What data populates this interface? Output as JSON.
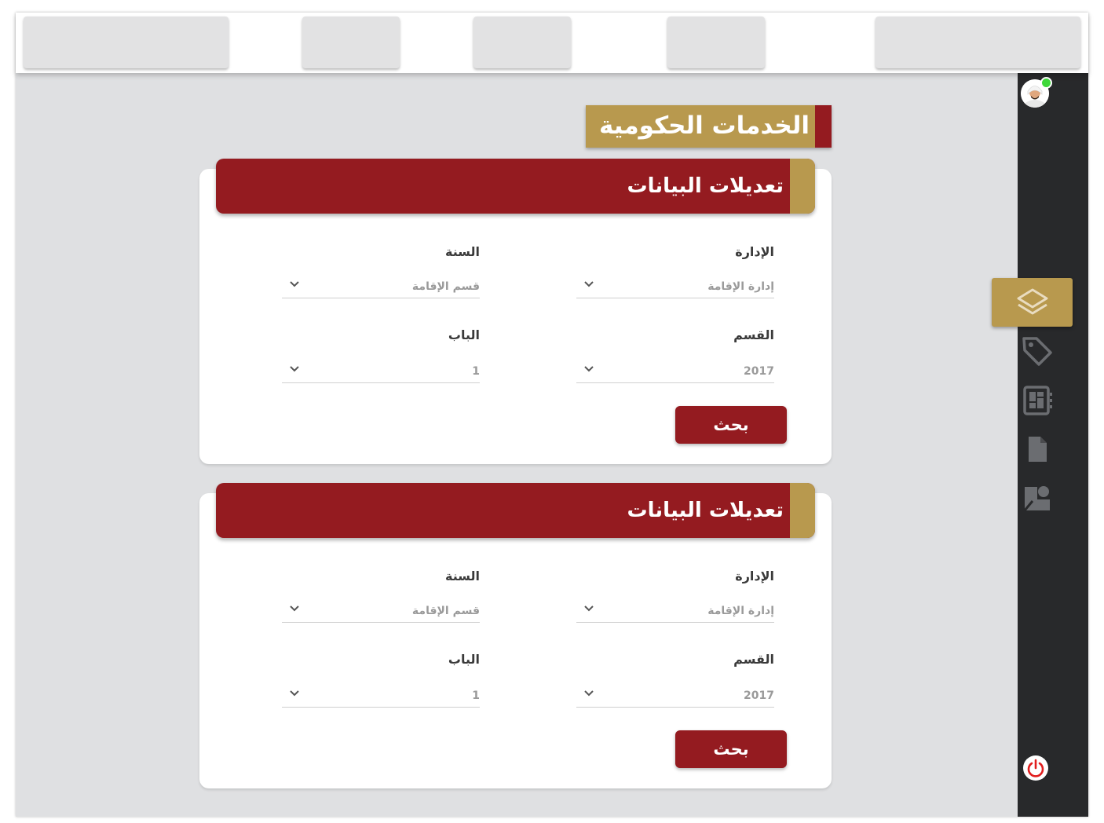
{
  "top_tabs": [
    "",
    "",
    "",
    "",
    ""
  ],
  "sidebar": {
    "user": "user-avatar",
    "status_color": "#3fd83a",
    "items": [
      {
        "icon": "layers-icon",
        "active": true
      },
      {
        "icon": "tag-icon",
        "active": false
      },
      {
        "icon": "dashboard-icon",
        "active": false
      },
      {
        "icon": "document-icon",
        "active": false
      },
      {
        "icon": "shapes-icon",
        "active": false
      }
    ],
    "logout_icon": "power-icon"
  },
  "page_title": "الخدمات الحكومية",
  "cards": [
    {
      "title": "تعديلات البيانات",
      "fields": {
        "department": {
          "label": "الإدارة",
          "value": "إدارة الإقامة"
        },
        "year": {
          "label": "السنة",
          "value": "قسم الإقامة"
        },
        "section": {
          "label": "القسم",
          "value": "2017"
        },
        "chapter": {
          "label": "الباب",
          "value": "1"
        }
      },
      "button": "بحث"
    },
    {
      "title": "تعديلات البيانات",
      "fields": {
        "department": {
          "label": "الإدارة",
          "value": "إدارة الإقامة"
        },
        "year": {
          "label": "السنة",
          "value": "قسم الإقامة"
        },
        "section": {
          "label": "القسم",
          "value": "2017"
        },
        "chapter": {
          "label": "الباب",
          "value": "1"
        }
      },
      "button": "بحث"
    }
  ],
  "colors": {
    "primary": "#941b20",
    "accent": "#b8994e",
    "sidebar": "#28292b",
    "background": "#dfe0e2"
  }
}
